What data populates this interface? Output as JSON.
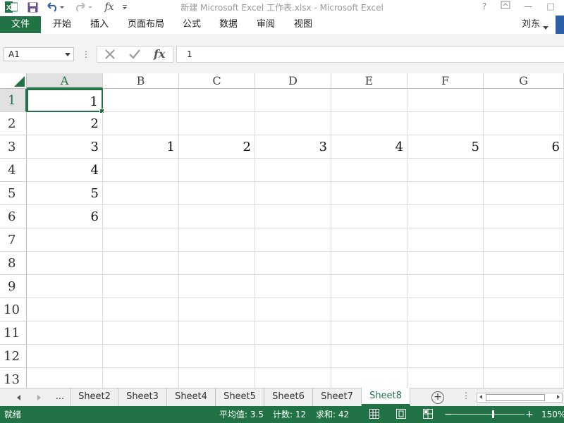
{
  "window": {
    "title": "新建 Microsoft Excel 工作表.xlsx - Microsoft Excel",
    "help": "?",
    "minimize": "—",
    "maximize": "□"
  },
  "ribbon": {
    "file": "文件",
    "tabs": [
      "开始",
      "插入",
      "页面布局",
      "公式",
      "数据",
      "审阅",
      "视图"
    ],
    "user": "刘东"
  },
  "formula_bar": {
    "name_box": "A1",
    "dots": "⋮",
    "formula": "1",
    "fx": "fx"
  },
  "grid": {
    "columns": [
      "A",
      "B",
      "C",
      "D",
      "E",
      "F",
      "G"
    ],
    "rows": [
      "1",
      "2",
      "3",
      "4",
      "5",
      "6",
      "7",
      "8",
      "9",
      "10",
      "11",
      "12",
      "13"
    ],
    "active_cell": "A1",
    "cells": {
      "A1": "1",
      "A2": "2",
      "A3": "3",
      "A4": "4",
      "A5": "5",
      "A6": "6",
      "B3": "1",
      "C3": "2",
      "D3": "3",
      "E3": "4",
      "F3": "5",
      "G3": "6"
    }
  },
  "sheets": {
    "ellipsis": "...",
    "tabs": [
      "Sheet2",
      "Sheet3",
      "Sheet4",
      "Sheet5",
      "Sheet6",
      "Sheet7",
      "Sheet8"
    ],
    "active": "Sheet8",
    "add": "+",
    "dots": "⋮"
  },
  "status": {
    "ready": "就绪",
    "average": "平均值: 3.5",
    "count": "计数: 12",
    "sum": "求和: 42",
    "zoom": "150%",
    "zoom_minus": "−",
    "zoom_plus": "+"
  },
  "colors": {
    "accent": "#217346"
  }
}
